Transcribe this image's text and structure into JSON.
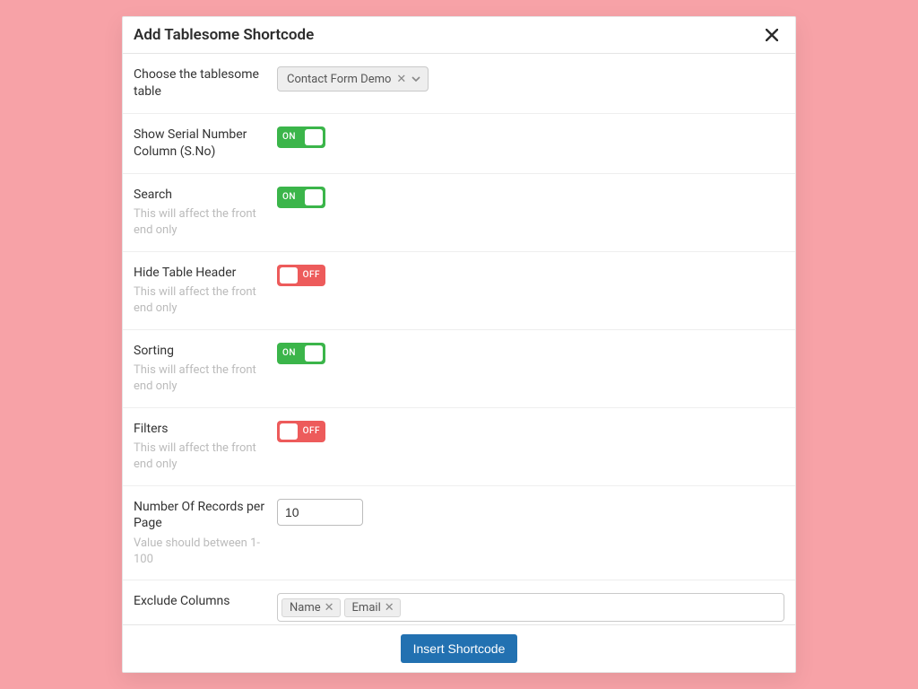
{
  "modal": {
    "title": "Add Tablesome Shortcode",
    "footer_button": "Insert Shortcode"
  },
  "help": {
    "front_only": "This will affect the front end only",
    "records_range": "Value should between 1-100"
  },
  "toggle_labels": {
    "on": "ON",
    "off": "OFF"
  },
  "fields": {
    "choose_table": {
      "label": "Choose the tablesome table",
      "selected": "Contact Form Demo"
    },
    "serial_no": {
      "label": "Show Serial Number Column (S.No)",
      "state": "on"
    },
    "search": {
      "label": "Search",
      "state": "on"
    },
    "hide_header": {
      "label": "Hide Table Header",
      "state": "off"
    },
    "sorting": {
      "label": "Sorting",
      "state": "on"
    },
    "filters": {
      "label": "Filters",
      "state": "off"
    },
    "records": {
      "label": "Number Of Records per Page",
      "value": "10"
    },
    "exclude": {
      "label": "Exclude Columns",
      "tags": [
        "Name",
        "Email"
      ]
    }
  }
}
